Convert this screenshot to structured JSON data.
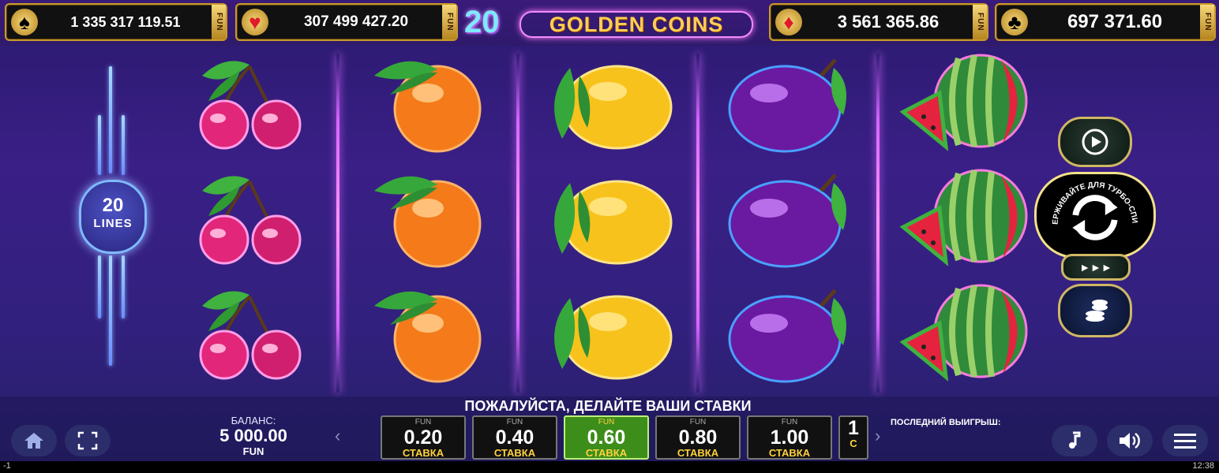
{
  "jackpots": [
    {
      "suit": "♠",
      "value": "1 335 317 119.51",
      "fun": "FUN"
    },
    {
      "suit": "♥",
      "value": "307 499 427.20",
      "fun": "FUN"
    },
    {
      "suit": "♦",
      "value": "3 561 365.86",
      "fun": "FUN"
    },
    {
      "suit": "♣",
      "value": "697 371.60",
      "fun": "FUN"
    }
  ],
  "logo": {
    "number": "20",
    "title": "GOLDEN COINS"
  },
  "lines": {
    "count": "20",
    "label": "LINES"
  },
  "reels": [
    [
      "cherry",
      "cherry",
      "cherry"
    ],
    [
      "orange",
      "orange",
      "orange"
    ],
    [
      "lemon",
      "lemon",
      "lemon"
    ],
    [
      "plum",
      "plum",
      "plum"
    ],
    [
      "watermelon",
      "watermelon",
      "watermelon"
    ]
  ],
  "side": {
    "turbo_hint": "УДЕРЖИВАЙТЕ ДЛЯ ТУРБО-СПИНА",
    "fast_icon": "►►►"
  },
  "balance": {
    "label": "БАЛАНС:",
    "value": "5 000.00",
    "currency": "FUN"
  },
  "prompt": "ПОЖАЛУЙСТА, ДЕЛАЙТЕ ВАШИ СТАВКИ",
  "bets": [
    {
      "fun": "FUN",
      "value": "0.20",
      "label": "СТАВКА"
    },
    {
      "fun": "FUN",
      "value": "0.40",
      "label": "СТАВКА"
    },
    {
      "fun": "FUN",
      "value": "0.60",
      "label": "СТАВКА",
      "selected": true
    },
    {
      "fun": "FUN",
      "value": "0.80",
      "label": "СТАВКА"
    },
    {
      "fun": "FUN",
      "value": "1.00",
      "label": "СТАВКА"
    },
    {
      "fun": "",
      "value": "1",
      "label": "С"
    }
  ],
  "nav": {
    "prev": "‹",
    "next": "›"
  },
  "last_win": {
    "label": "ПОСЛЕДНИЙ ВЫИГРЫШ:"
  },
  "status": {
    "left": "-1",
    "time": "12:38"
  },
  "colors": {
    "accent": "#d666ff",
    "gold": "#c99a2a",
    "selected": "#3d8d1a",
    "bet_label": "#ffd23f"
  }
}
